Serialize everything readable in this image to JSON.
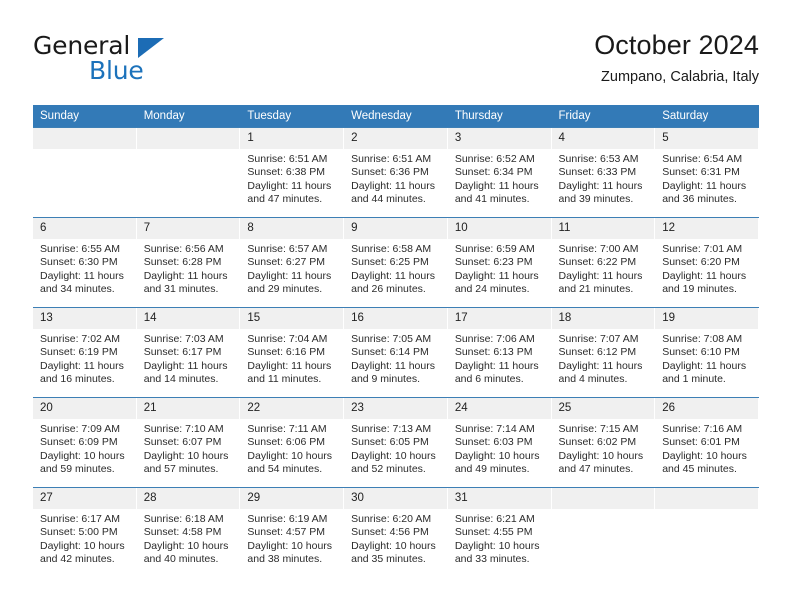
{
  "brand": {
    "line1": "General",
    "line2": "Blue",
    "triangle_color": "#1c6cb5",
    "blue_color": "#1c72bb"
  },
  "header": {
    "title": "October 2024",
    "subtitle": "Zumpano, Calabria, Italy"
  },
  "theme": {
    "header_bg": "#337ab7",
    "daynum_bg": "#f0f0f0",
    "row_divider": "#3d7fb5"
  },
  "calendar": {
    "weekday_headers": [
      "Sunday",
      "Monday",
      "Tuesday",
      "Wednesday",
      "Thursday",
      "Friday",
      "Saturday"
    ],
    "labels": {
      "sunrise": "Sunrise:",
      "sunset": "Sunset:",
      "daylight": "Daylight:"
    },
    "weeks": [
      [
        {
          "day": ""
        },
        {
          "day": ""
        },
        {
          "day": "1",
          "sunrise": "Sunrise: 6:51 AM",
          "sunset": "Sunset: 6:38 PM",
          "daylight1": "Daylight: 11 hours",
          "daylight2": "and 47 minutes."
        },
        {
          "day": "2",
          "sunrise": "Sunrise: 6:51 AM",
          "sunset": "Sunset: 6:36 PM",
          "daylight1": "Daylight: 11 hours",
          "daylight2": "and 44 minutes."
        },
        {
          "day": "3",
          "sunrise": "Sunrise: 6:52 AM",
          "sunset": "Sunset: 6:34 PM",
          "daylight1": "Daylight: 11 hours",
          "daylight2": "and 41 minutes."
        },
        {
          "day": "4",
          "sunrise": "Sunrise: 6:53 AM",
          "sunset": "Sunset: 6:33 PM",
          "daylight1": "Daylight: 11 hours",
          "daylight2": "and 39 minutes."
        },
        {
          "day": "5",
          "sunrise": "Sunrise: 6:54 AM",
          "sunset": "Sunset: 6:31 PM",
          "daylight1": "Daylight: 11 hours",
          "daylight2": "and 36 minutes."
        }
      ],
      [
        {
          "day": "6",
          "sunrise": "Sunrise: 6:55 AM",
          "sunset": "Sunset: 6:30 PM",
          "daylight1": "Daylight: 11 hours",
          "daylight2": "and 34 minutes."
        },
        {
          "day": "7",
          "sunrise": "Sunrise: 6:56 AM",
          "sunset": "Sunset: 6:28 PM",
          "daylight1": "Daylight: 11 hours",
          "daylight2": "and 31 minutes."
        },
        {
          "day": "8",
          "sunrise": "Sunrise: 6:57 AM",
          "sunset": "Sunset: 6:27 PM",
          "daylight1": "Daylight: 11 hours",
          "daylight2": "and 29 minutes."
        },
        {
          "day": "9",
          "sunrise": "Sunrise: 6:58 AM",
          "sunset": "Sunset: 6:25 PM",
          "daylight1": "Daylight: 11 hours",
          "daylight2": "and 26 minutes."
        },
        {
          "day": "10",
          "sunrise": "Sunrise: 6:59 AM",
          "sunset": "Sunset: 6:23 PM",
          "daylight1": "Daylight: 11 hours",
          "daylight2": "and 24 minutes."
        },
        {
          "day": "11",
          "sunrise": "Sunrise: 7:00 AM",
          "sunset": "Sunset: 6:22 PM",
          "daylight1": "Daylight: 11 hours",
          "daylight2": "and 21 minutes."
        },
        {
          "day": "12",
          "sunrise": "Sunrise: 7:01 AM",
          "sunset": "Sunset: 6:20 PM",
          "daylight1": "Daylight: 11 hours",
          "daylight2": "and 19 minutes."
        }
      ],
      [
        {
          "day": "13",
          "sunrise": "Sunrise: 7:02 AM",
          "sunset": "Sunset: 6:19 PM",
          "daylight1": "Daylight: 11 hours",
          "daylight2": "and 16 minutes."
        },
        {
          "day": "14",
          "sunrise": "Sunrise: 7:03 AM",
          "sunset": "Sunset: 6:17 PM",
          "daylight1": "Daylight: 11 hours",
          "daylight2": "and 14 minutes."
        },
        {
          "day": "15",
          "sunrise": "Sunrise: 7:04 AM",
          "sunset": "Sunset: 6:16 PM",
          "daylight1": "Daylight: 11 hours",
          "daylight2": "and 11 minutes."
        },
        {
          "day": "16",
          "sunrise": "Sunrise: 7:05 AM",
          "sunset": "Sunset: 6:14 PM",
          "daylight1": "Daylight: 11 hours",
          "daylight2": "and 9 minutes."
        },
        {
          "day": "17",
          "sunrise": "Sunrise: 7:06 AM",
          "sunset": "Sunset: 6:13 PM",
          "daylight1": "Daylight: 11 hours",
          "daylight2": "and 6 minutes."
        },
        {
          "day": "18",
          "sunrise": "Sunrise: 7:07 AM",
          "sunset": "Sunset: 6:12 PM",
          "daylight1": "Daylight: 11 hours",
          "daylight2": "and 4 minutes."
        },
        {
          "day": "19",
          "sunrise": "Sunrise: 7:08 AM",
          "sunset": "Sunset: 6:10 PM",
          "daylight1": "Daylight: 11 hours",
          "daylight2": "and 1 minute."
        }
      ],
      [
        {
          "day": "20",
          "sunrise": "Sunrise: 7:09 AM",
          "sunset": "Sunset: 6:09 PM",
          "daylight1": "Daylight: 10 hours",
          "daylight2": "and 59 minutes."
        },
        {
          "day": "21",
          "sunrise": "Sunrise: 7:10 AM",
          "sunset": "Sunset: 6:07 PM",
          "daylight1": "Daylight: 10 hours",
          "daylight2": "and 57 minutes."
        },
        {
          "day": "22",
          "sunrise": "Sunrise: 7:11 AM",
          "sunset": "Sunset: 6:06 PM",
          "daylight1": "Daylight: 10 hours",
          "daylight2": "and 54 minutes."
        },
        {
          "day": "23",
          "sunrise": "Sunrise: 7:13 AM",
          "sunset": "Sunset: 6:05 PM",
          "daylight1": "Daylight: 10 hours",
          "daylight2": "and 52 minutes."
        },
        {
          "day": "24",
          "sunrise": "Sunrise: 7:14 AM",
          "sunset": "Sunset: 6:03 PM",
          "daylight1": "Daylight: 10 hours",
          "daylight2": "and 49 minutes."
        },
        {
          "day": "25",
          "sunrise": "Sunrise: 7:15 AM",
          "sunset": "Sunset: 6:02 PM",
          "daylight1": "Daylight: 10 hours",
          "daylight2": "and 47 minutes."
        },
        {
          "day": "26",
          "sunrise": "Sunrise: 7:16 AM",
          "sunset": "Sunset: 6:01 PM",
          "daylight1": "Daylight: 10 hours",
          "daylight2": "and 45 minutes."
        }
      ],
      [
        {
          "day": "27",
          "sunrise": "Sunrise: 6:17 AM",
          "sunset": "Sunset: 5:00 PM",
          "daylight1": "Daylight: 10 hours",
          "daylight2": "and 42 minutes."
        },
        {
          "day": "28",
          "sunrise": "Sunrise: 6:18 AM",
          "sunset": "Sunset: 4:58 PM",
          "daylight1": "Daylight: 10 hours",
          "daylight2": "and 40 minutes."
        },
        {
          "day": "29",
          "sunrise": "Sunrise: 6:19 AM",
          "sunset": "Sunset: 4:57 PM",
          "daylight1": "Daylight: 10 hours",
          "daylight2": "and 38 minutes."
        },
        {
          "day": "30",
          "sunrise": "Sunrise: 6:20 AM",
          "sunset": "Sunset: 4:56 PM",
          "daylight1": "Daylight: 10 hours",
          "daylight2": "and 35 minutes."
        },
        {
          "day": "31",
          "sunrise": "Sunrise: 6:21 AM",
          "sunset": "Sunset: 4:55 PM",
          "daylight1": "Daylight: 10 hours",
          "daylight2": "and 33 minutes."
        },
        {
          "day": ""
        },
        {
          "day": ""
        }
      ]
    ]
  }
}
